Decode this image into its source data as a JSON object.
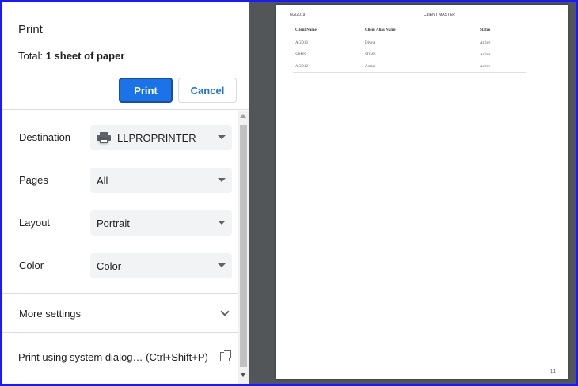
{
  "dialog": {
    "title": "Print",
    "summary_prefix": "Total: ",
    "summary_value": "1 sheet of paper",
    "print_button": "Print",
    "cancel_button": "Cancel"
  },
  "settings": {
    "destination": {
      "label": "Destination",
      "value": "LLPROPRINTER"
    },
    "pages": {
      "label": "Pages",
      "value": "All"
    },
    "layout": {
      "label": "Layout",
      "value": "Portrait"
    },
    "color": {
      "label": "Color",
      "value": "Color"
    }
  },
  "more_settings": "More settings",
  "system_dialog": "Print using system dialog… (Ctrl+Shift+P)",
  "preview": {
    "date": "6/2/2019",
    "title": "CLIENT MASTER",
    "headers": [
      "Client Name",
      "Client Alias Name",
      "Status"
    ],
    "rows": [
      [
        "AGD13",
        "Divya",
        "Active"
      ],
      [
        "SDMS",
        "SDMS",
        "Active"
      ],
      [
        "AGD12",
        "Asmar",
        "Active"
      ]
    ],
    "page_number": "1/1"
  },
  "colors": {
    "accent": "#1a73e8",
    "frame_border": "#1a1aff",
    "preview_background": "#525659",
    "select_background": "#f1f3f4"
  }
}
